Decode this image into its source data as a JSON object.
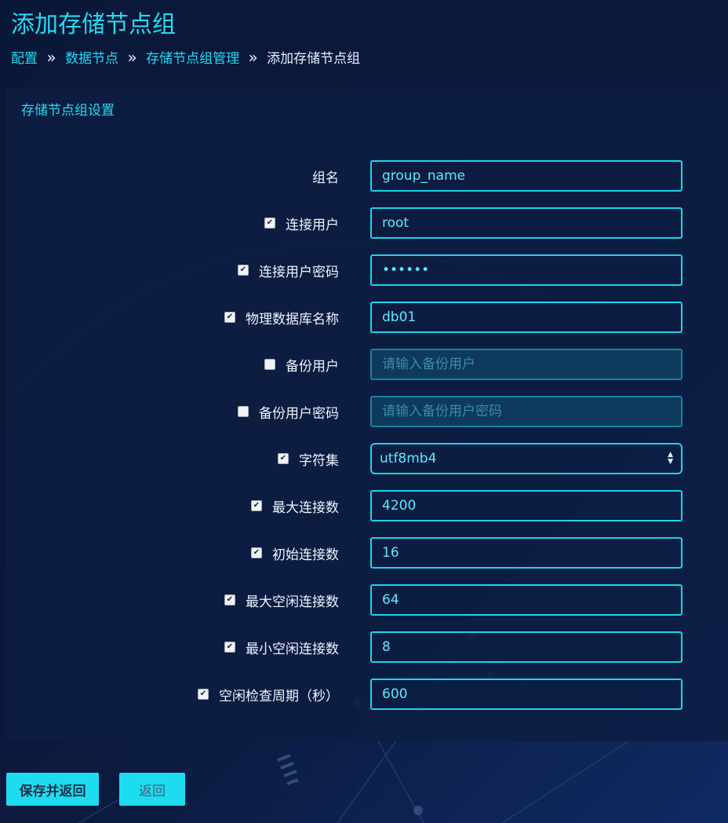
{
  "page": {
    "title": "添加存储节点组"
  },
  "breadcrumb": {
    "items": [
      "配置",
      "数据节点",
      "存储节点组管理",
      "添加存储节点组"
    ],
    "separator": "»"
  },
  "panel": {
    "title": "存储节点组设置"
  },
  "form": {
    "group_name": {
      "label": "组名",
      "value": "group_name"
    },
    "conn_user": {
      "label": "连接用户",
      "checked": true,
      "value": "root"
    },
    "conn_password": {
      "label": "连接用户密码",
      "checked": true,
      "value": "••••••"
    },
    "db_name": {
      "label": "物理数据库名称",
      "checked": true,
      "value": "db01"
    },
    "backup_user": {
      "label": "备份用户",
      "checked": false,
      "value": "",
      "placeholder": "请输入备份用户",
      "disabled": true
    },
    "backup_password": {
      "label": "备份用户密码",
      "checked": false,
      "value": "",
      "placeholder": "请输入备份用户密码",
      "disabled": true
    },
    "charset": {
      "label": "字符集",
      "checked": true,
      "value": "utf8mb4"
    },
    "max_conn": {
      "label": "最大连接数",
      "checked": true,
      "value": "4200"
    },
    "init_conn": {
      "label": "初始连接数",
      "checked": true,
      "value": "16"
    },
    "max_idle": {
      "label": "最大空闲连接数",
      "checked": true,
      "value": "64"
    },
    "min_idle": {
      "label": "最小空闲连接数",
      "checked": true,
      "value": "8"
    },
    "idle_check": {
      "label": "空闲检查周期（秒）",
      "checked": true,
      "value": "600"
    }
  },
  "buttons": {
    "save_label": "保存并返回",
    "back_label": "返回"
  },
  "icons": {
    "check_glyph": "✔",
    "select_up": "▲",
    "select_down": "▼"
  },
  "colors": {
    "accent": "#1ad5ec",
    "background": "#0b1a3d",
    "panel": "#0d1e42",
    "disabled_field": "#0e3a5e"
  }
}
